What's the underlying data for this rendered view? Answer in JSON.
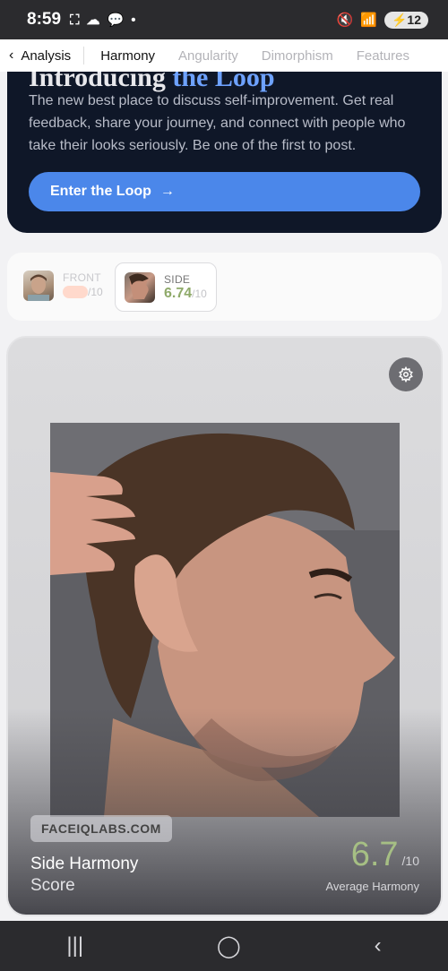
{
  "status": {
    "time": "8:59",
    "battery": "12"
  },
  "nav": {
    "back_label": "Analysis",
    "tabs": [
      {
        "label": "Harmony",
        "active": true
      },
      {
        "label": "Angularity",
        "active": false
      },
      {
        "label": "Dimorphism",
        "active": false
      },
      {
        "label": "Features",
        "active": false
      }
    ]
  },
  "promo": {
    "heading_prefix": "Introducing",
    "heading_accent": "the Loop",
    "body": "The new best place to discuss self-improvement. Get real feedback, share your journey, and connect with people who take their looks seriously. Be one of the first to post.",
    "button_label": "Enter the Loop"
  },
  "chips": {
    "front": {
      "label": "FRONT",
      "denominator": "/10"
    },
    "side": {
      "label": "SIDE",
      "score": "6.74",
      "denominator": "/10"
    }
  },
  "card": {
    "watermark": "FACEIQLABS.COM",
    "title": "Side Harmony",
    "subtitle": "Score",
    "score": "6.7",
    "denominator": "/10",
    "score_label": "Average Harmony"
  },
  "colors": {
    "accent_blue": "#4b87ea",
    "score_green": "#a6bf84"
  }
}
